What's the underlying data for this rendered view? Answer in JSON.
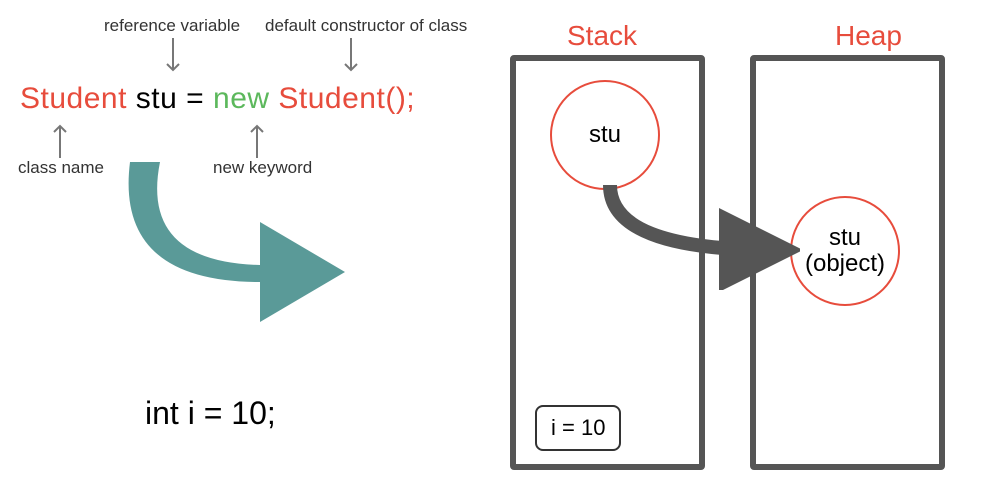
{
  "labels": {
    "reference_variable": "reference variable",
    "default_constructor": "default constructor of class",
    "class_name": "class name",
    "new_keyword": "new keyword"
  },
  "code": {
    "type_name": "Student",
    "var_name": "stu",
    "equals": "=",
    "new_kw": "new",
    "constructor_call": "Student();"
  },
  "int_line": "int i = 10;",
  "memory": {
    "stack_header": "Stack",
    "heap_header": "Heap",
    "stack_circle": "stu",
    "heap_circle_line1": "stu",
    "heap_circle_line2": "(object)",
    "stack_var": "i = 10"
  }
}
